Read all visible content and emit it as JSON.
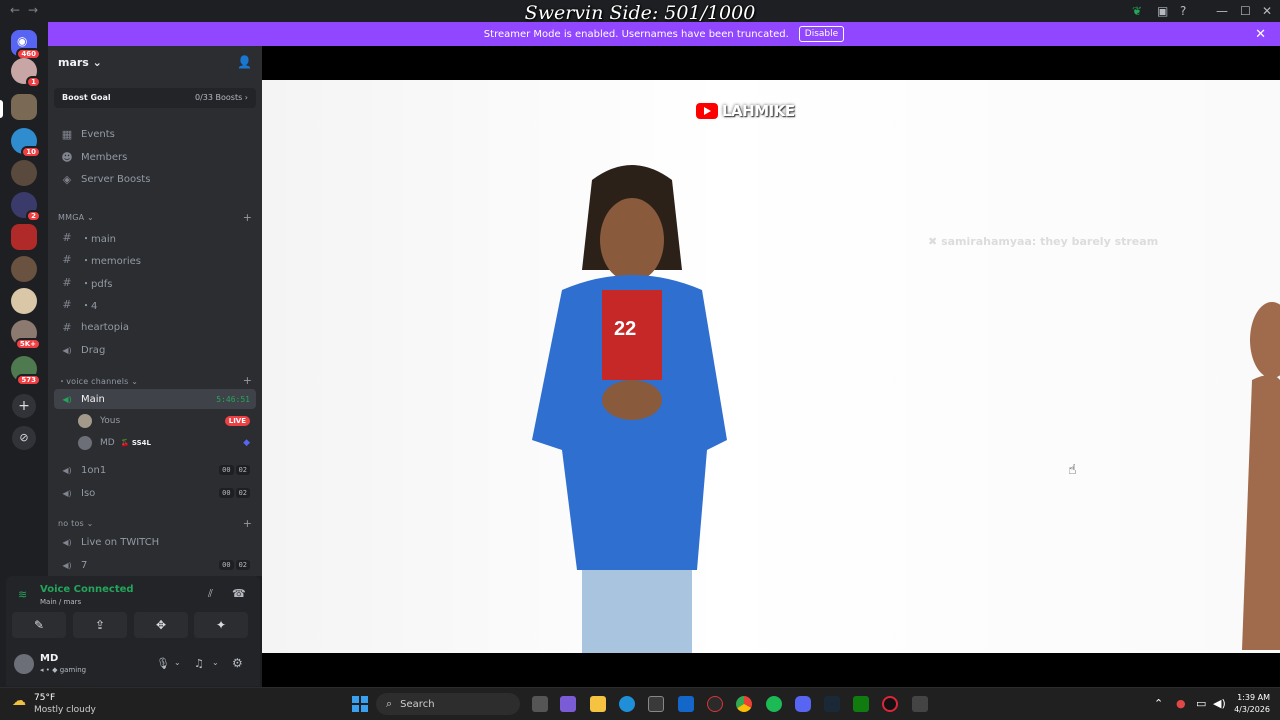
{
  "overlay": {
    "title": "Swervin Side: 501/1000"
  },
  "titlebar": {
    "back": "←",
    "forward": "→",
    "minimize": "—",
    "maximize": "☐",
    "close": "✕"
  },
  "banner": {
    "message": "Streamer Mode is enabled. Usernames have been truncated.",
    "disable_label": "Disable",
    "close": "✕"
  },
  "rail": {
    "badges": [
      "460",
      "1",
      "10",
      "2",
      "5K+",
      "573"
    ],
    "add_label": "+",
    "discover_label": "⊘"
  },
  "sidebar": {
    "server_name": "mars ⌄",
    "boost": {
      "label": "Boost Goal",
      "progress": "0/33 Boosts ›"
    },
    "nav": [
      {
        "label": "Events",
        "icon": "calendar-icon",
        "glyph": "▦"
      },
      {
        "label": "Members",
        "icon": "members-icon",
        "glyph": "☻"
      },
      {
        "label": "Server Boosts",
        "icon": "boost-icon",
        "glyph": "◈"
      }
    ],
    "category_mmga": "MMGA ⌄",
    "text_channels": [
      {
        "label": "・main",
        "glyph": "#"
      },
      {
        "label": "・memories",
        "glyph": "#"
      },
      {
        "label": "・pdfs",
        "glyph": "#"
      },
      {
        "label": "・4",
        "glyph": "#"
      },
      {
        "label": "heartopia",
        "glyph": "#"
      },
      {
        "label": "Drag",
        "glyph": "◀)"
      }
    ],
    "category_voice": "・voice channels ⌄",
    "voice_main": {
      "label": "Main",
      "timer": "5:46:51",
      "glyph": "◀)"
    },
    "voice_users": [
      {
        "name": "Yous",
        "tag": "",
        "live": "LIVE"
      },
      {
        "name": "MD",
        "tag": "🍒 SS4L",
        "live": ""
      }
    ],
    "voice_channels": [
      {
        "label": "1on1",
        "c1": "00",
        "c2": "02"
      },
      {
        "label": "Iso",
        "c1": "00",
        "c2": "02"
      }
    ],
    "category_notos": "no tos ⌄",
    "notos_channels": [
      {
        "label": "Live on TWITCH",
        "c1": "",
        "c2": ""
      },
      {
        "label": "7",
        "c1": "00",
        "c2": "02"
      }
    ],
    "add": "+"
  },
  "voice_panel": {
    "status": "Voice Connected",
    "location": "Main / mars",
    "buttons": [
      "✎",
      "⇪",
      "✥",
      "✦"
    ]
  },
  "user_panel": {
    "name": "MD",
    "status": "gaming"
  },
  "stream": {
    "watermark": "LAHMIKE",
    "chat_message": "samirahamyaa: they barely stream"
  },
  "taskbar": {
    "weather_temp": "75°F",
    "weather_desc": "Mostly cloudy",
    "search_placeholder": "Search",
    "time": "1:39 AM",
    "date": "4/3/2026"
  },
  "colors": {
    "banner": "#9146ff",
    "live": "#ed4245",
    "voice_connected": "#23a55a"
  }
}
